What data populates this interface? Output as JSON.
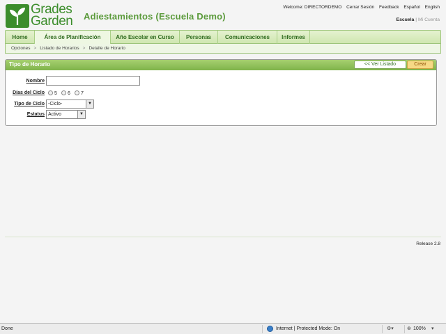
{
  "header": {
    "logo_text_line1": "Grades",
    "logo_text_line2": "Garden",
    "app_title": "Adiestamientos (Escuela Demo)",
    "welcome": "Welcome: DIRECTORDEMO",
    "links": [
      "Cerrar Sesión",
      "Feedback",
      "Español",
      "English"
    ],
    "account_current": "Escuela",
    "account_other": "Mi Cuenta"
  },
  "nav": {
    "items": [
      "Home",
      "Área de Planificación",
      "Año Escolar en Curso",
      "Personas",
      "Comunicaciones",
      "Informes"
    ],
    "active": "Área de Planificación"
  },
  "breadcrumb": [
    "Opciones",
    "Listado de Horarios",
    "Detalle de Horario"
  ],
  "panel": {
    "title": "Tipo de Horario",
    "list_button": "<< Ver Listado",
    "create_button": "Crear"
  },
  "form": {
    "nombre_label": "Nombre",
    "nombre_value": "",
    "dias_label": "Días del Ciclo",
    "dias_options": [
      "5",
      "6",
      "7"
    ],
    "tipo_label": "Tipo de Ciclo",
    "tipo_value": "-Ciclo-",
    "estatus_label": "Estatus",
    "estatus_value": "Activo"
  },
  "footer": {
    "release": "Release 2.8"
  },
  "statusbar": {
    "left": "Done",
    "zone": "Internet | Protected Mode: On",
    "zoom": "100%"
  },
  "colors": {
    "brand_green": "#3c8d2c",
    "nav_text": "#2f6b1f",
    "panel_header": "#7fb34a",
    "create_button": "#f6d985"
  }
}
